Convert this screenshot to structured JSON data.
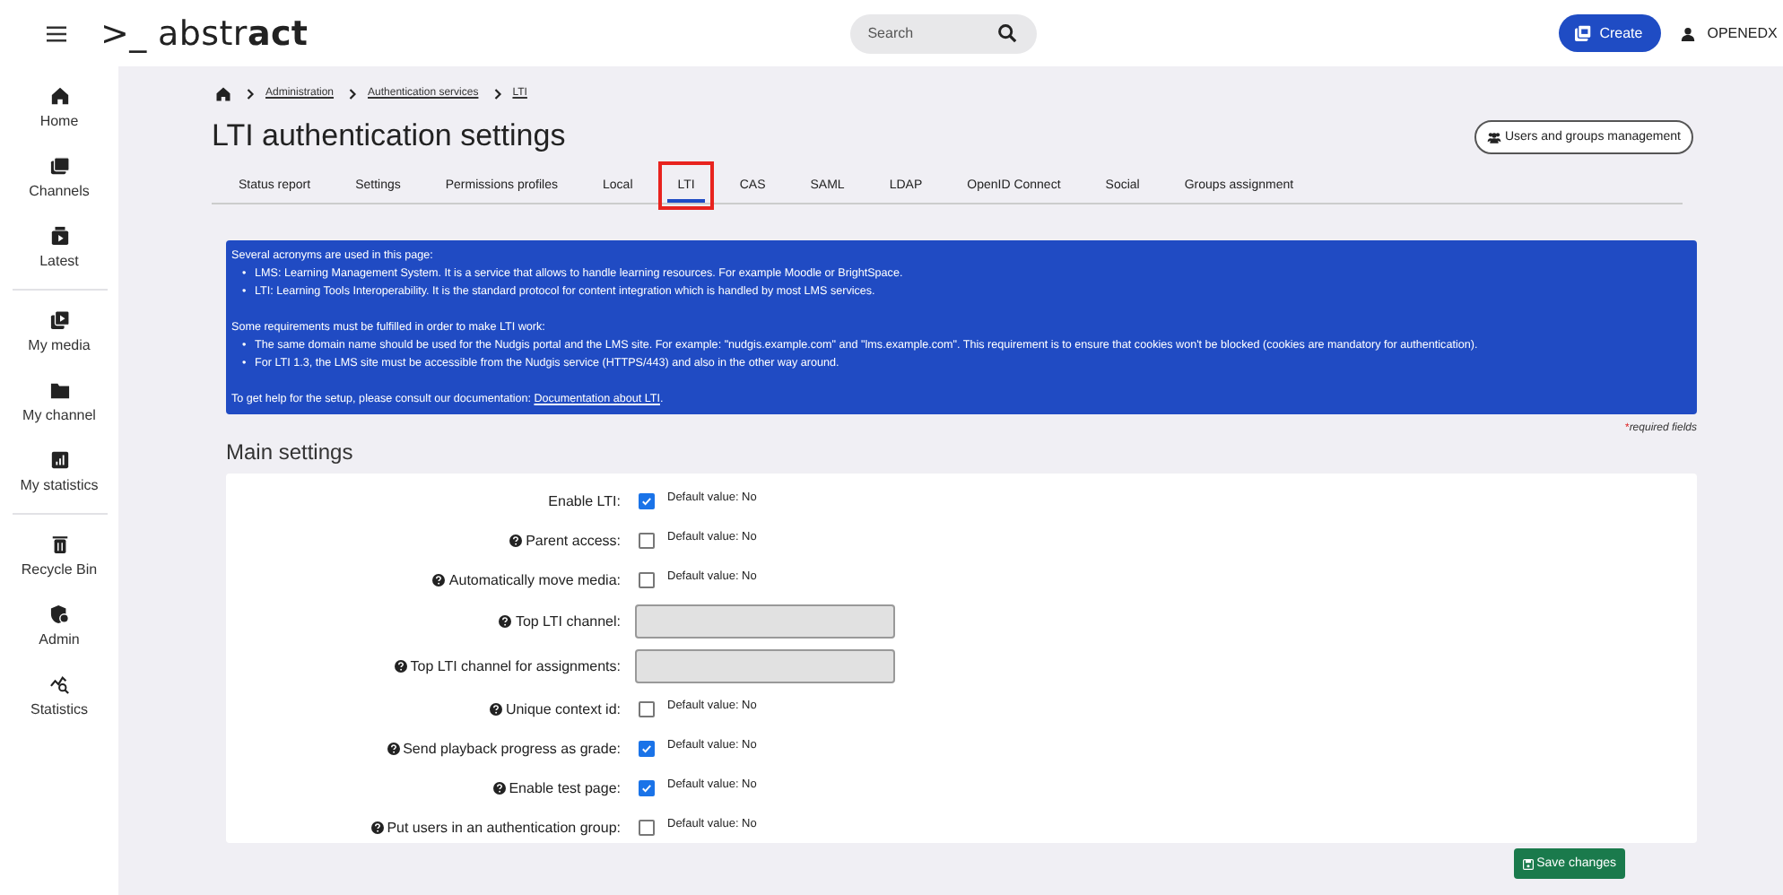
{
  "header": {
    "logo_prefix": ">_ abstr",
    "logo_bold": "act",
    "search": {
      "placeholder": "Search"
    },
    "create_button": "Create",
    "user": "OPENEDX"
  },
  "sidebar": {
    "groups": [
      [
        {
          "label": "Home",
          "kind": "home"
        },
        {
          "label": "Channels",
          "kind": "channels"
        },
        {
          "label": "Latest",
          "kind": "latest"
        }
      ],
      [
        {
          "label": "My media",
          "kind": "media"
        },
        {
          "label": "My channel",
          "kind": "folder"
        },
        {
          "label": "My statistics",
          "kind": "stats"
        }
      ],
      [
        {
          "label": "Recycle Bin",
          "kind": "bin"
        },
        {
          "label": "Admin",
          "kind": "admin"
        },
        {
          "label": "Statistics",
          "kind": "statistics"
        }
      ]
    ]
  },
  "breadcrumb": [
    "Administration",
    "Authentication services",
    "LTI"
  ],
  "title": "LTI authentication settings",
  "users_button": "Users and groups management",
  "tabs": [
    {
      "label": "Status report",
      "selected": false,
      "highlighted": false
    },
    {
      "label": "Settings",
      "selected": false,
      "highlighted": false
    },
    {
      "label": "Permissions profiles",
      "selected": false,
      "highlighted": false
    },
    {
      "label": "Local",
      "selected": false,
      "highlighted": false
    },
    {
      "label": "LTI",
      "selected": true,
      "highlighted": true
    },
    {
      "label": "CAS",
      "selected": false,
      "highlighted": false
    },
    {
      "label": "SAML",
      "selected": false,
      "highlighted": false
    },
    {
      "label": "LDAP",
      "selected": false,
      "highlighted": false
    },
    {
      "label": "OpenID Connect",
      "selected": false,
      "highlighted": false
    },
    {
      "label": "Social",
      "selected": false,
      "highlighted": false
    },
    {
      "label": "Groups assignment",
      "selected": false,
      "highlighted": false
    }
  ],
  "info": {
    "sections": [
      {
        "intro": "Several acronyms are used in this page:",
        "items": [
          {
            "marker": "•",
            "text": "LMS: Learning Management System. It is a service that allows to handle learning resources. For example Moodle or BrightSpace."
          },
          {
            "marker": "•",
            "text": "LTI: Learning Tools Interoperability. It is the standard protocol for content integration which is handled by most LMS services."
          }
        ]
      },
      {
        "intro": "Some requirements must be fulfilled in order to make LTI work:",
        "items": [
          {
            "marker": "•",
            "text": "The same domain name should be used for the Nudgis portal and the LMS site. For example: \"nudgis.example.com\" and \"lms.example.com\". This requirement is to ensure that cookies won't be blocked (cookies are mandatory for authentication)."
          },
          {
            "marker": "•",
            "text": "For LTI 1.3, the LMS site must be accessible from the Nudgis service (HTTPS/443) and also in the other way around."
          }
        ]
      }
    ],
    "help_text": "To get help for the setup, please consult our documentation:",
    "help_link": "Documentation about LTI",
    "help_end": "."
  },
  "required_note": "required fields",
  "required_mark": "*",
  "section_title": "Main settings",
  "fields": [
    {
      "kind": "checkbox",
      "label": "Enable LTI:",
      "help": false,
      "checked": true,
      "note": "Default value: No"
    },
    {
      "kind": "checkbox",
      "label": "Parent access:",
      "help": true,
      "checked": false,
      "note": "Default value: No"
    },
    {
      "kind": "checkbox",
      "label": "Automatically move media:",
      "help": true,
      "checked": false,
      "note": "Default value: No"
    },
    {
      "kind": "text",
      "label": "Top LTI channel:",
      "help": true
    },
    {
      "kind": "text",
      "label": "Top LTI channel for assignments:",
      "help": true
    },
    {
      "kind": "checkbox",
      "label": "Unique context id:",
      "help": true,
      "checked": false,
      "note": "Default value: No"
    },
    {
      "kind": "checkbox",
      "label": "Send playback progress as grade:",
      "help": true,
      "checked": true,
      "note": "Default value: No"
    },
    {
      "kind": "checkbox",
      "label": "Enable test page:",
      "help": true,
      "checked": true,
      "note": "Default value: No"
    },
    {
      "kind": "checkbox",
      "label": "Put users in an authentication group:",
      "help": true,
      "checked": false,
      "note": "Default value: No"
    }
  ],
  "save_button": "Save changes"
}
